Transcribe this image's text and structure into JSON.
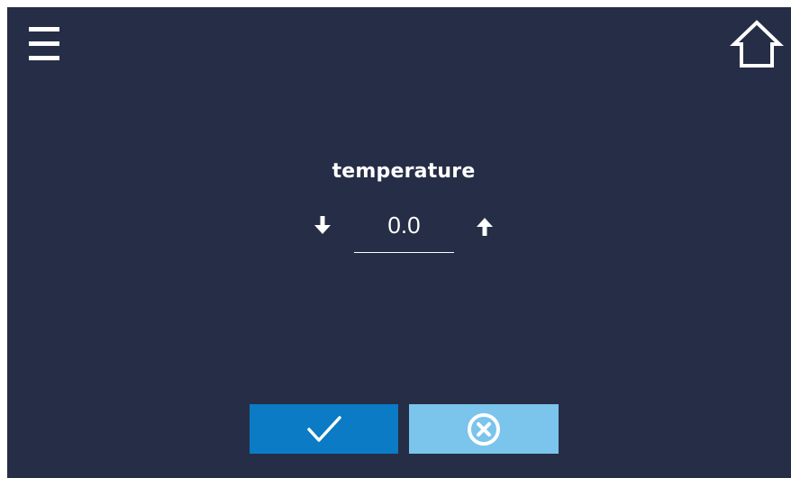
{
  "screen": {
    "background": "#262d46"
  },
  "header": {
    "menu_icon": "hamburger-menu-icon",
    "home_icon": "home-icon"
  },
  "setpoint": {
    "label": "temperature",
    "value": "0.0",
    "decrease_icon": "arrow-down-icon",
    "increase_icon": "arrow-up-icon"
  },
  "actions": {
    "confirm_icon": "check-icon",
    "confirm_color": "#0a7bc4",
    "cancel_icon": "cancel-circle-icon",
    "cancel_color": "#7bc4ec"
  }
}
